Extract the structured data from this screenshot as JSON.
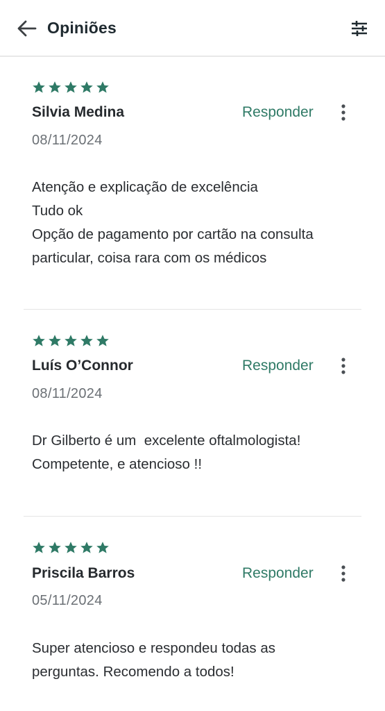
{
  "header": {
    "title": "Opiniões",
    "back_icon": "arrow-left-icon",
    "filter_icon": "sliders-icon"
  },
  "colors": {
    "accent": "#2f7a66",
    "text": "#202124",
    "muted": "#6b7075",
    "divider": "#e4e4e4"
  },
  "reply_label": "Responder",
  "reviews": [
    {
      "rating": 5,
      "author": "Silvia Medina",
      "date": "08/11/2024",
      "lines": [
        "Atenção e explicação de excelência",
        "Tudo ok",
        "Opção de pagamento por cartão na consulta",
        "particular, coisa rara com os médicos"
      ]
    },
    {
      "rating": 5,
      "author": "Luís O’Connor",
      "date": "08/11/2024",
      "lines": [
        "Dr Gilberto é um  excelente oftalmologista!",
        "Competente, e atencioso !!"
      ]
    },
    {
      "rating": 5,
      "author": "Priscila Barros",
      "date": "05/11/2024",
      "lines": [
        "Super atencioso e respondeu todas as",
        "perguntas. Recomendo a todos!"
      ]
    }
  ]
}
